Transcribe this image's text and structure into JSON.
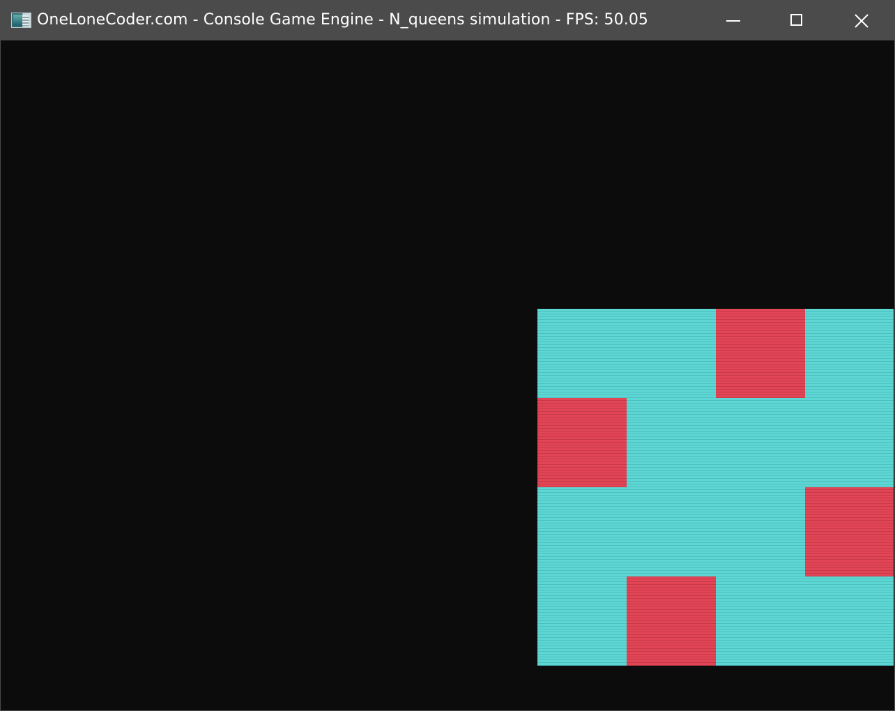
{
  "window": {
    "title": "OneLoneCoder.com - Console Game Engine - N_queens simulation - FPS: 50.05",
    "icon": "console-app-icon",
    "controls": {
      "minimize_icon": "minimize-icon",
      "maximize_icon": "maximize-icon",
      "close_icon": "close-icon"
    }
  },
  "game": {
    "board_size": 4,
    "queen_columns_by_row": [
      2,
      0,
      3,
      1
    ],
    "colors": {
      "background": "#0c0c0c",
      "empty_cell": "#5ed6d4",
      "queen_cell": "#e24555",
      "titlebar": "#4b4b4b"
    }
  }
}
